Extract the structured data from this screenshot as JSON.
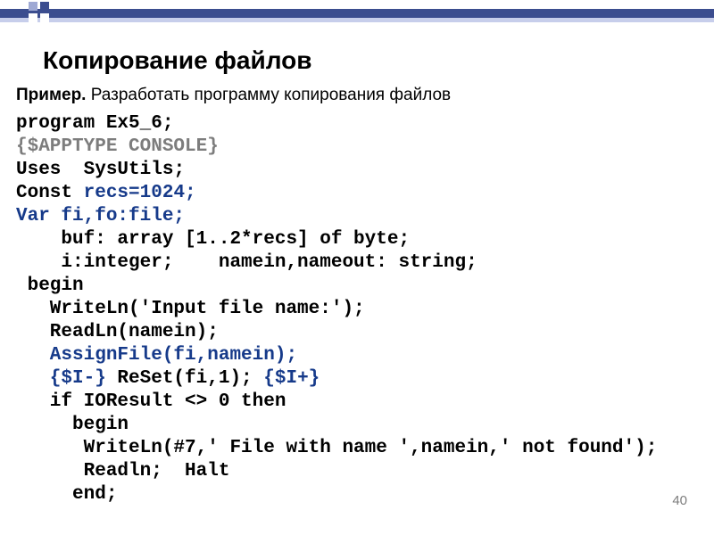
{
  "header": {
    "title": "Копирование файлов",
    "example_label": "Пример.",
    "example_text": " Разработать программу копирования файлов"
  },
  "code": {
    "l1_program": "program",
    "l1_name": " Ex5_6;",
    "l2_directive": "{$APPTYPE CONSOLE}",
    "l3_uses": "Uses",
    "l3_rest": "  SysUtils;",
    "l4_const": "Const ",
    "l4_rest": "recs=1024;",
    "l5_var": "Var fi,fo:file;",
    "l6_buf": "    buf: array [1..2*recs] of byte;",
    "l7_int": "    i:integer;    namein,nameout: string;",
    "l8_begin": " begin",
    "l9_writeln": "   WriteLn('Input file name:');",
    "l10_readln": "   ReadLn(namein);",
    "l11_assign": "   AssignFile(fi,namein);",
    "l12_a": "   {$I-} ",
    "l12_b": "ReSet(fi,1);",
    "l12_c": " {$I+}",
    "l13_if": "   if IOResult <> 0 then",
    "l14_begin2": "     begin",
    "l15_writeln2": "      WriteLn(#7,' File with name ',namein,' not found');",
    "l16_halt": "      Readln;  Halt",
    "l17_end": "     end;"
  },
  "page_number": "40"
}
